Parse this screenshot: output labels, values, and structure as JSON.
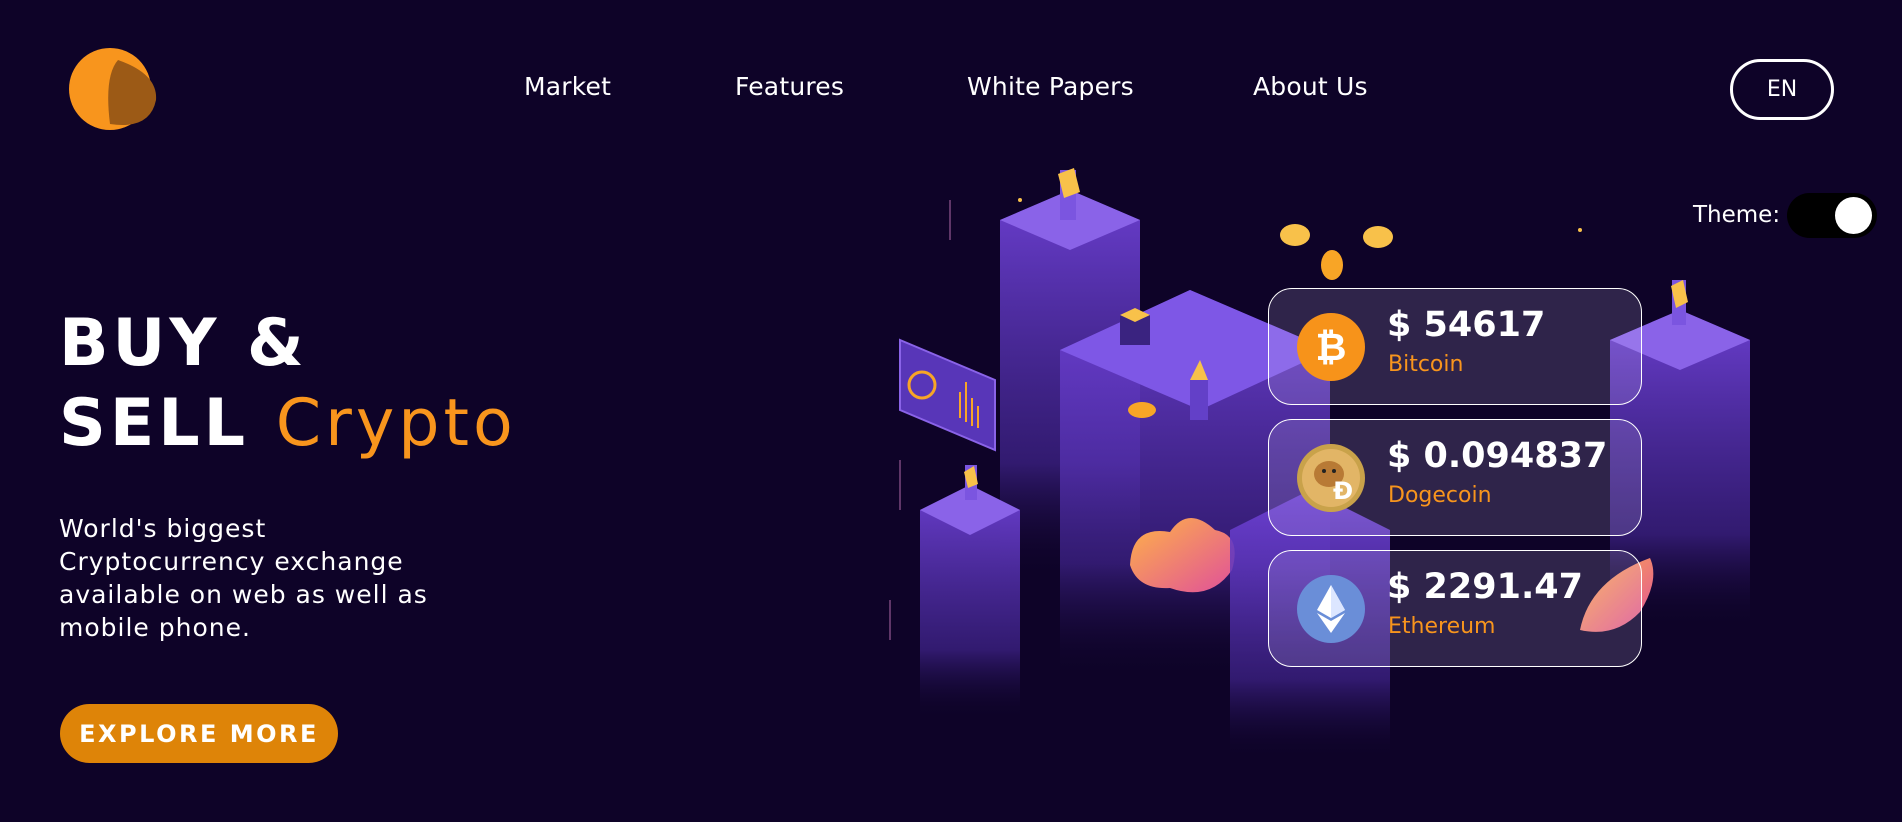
{
  "nav": {
    "items": [
      {
        "label": "Market"
      },
      {
        "label": "Features"
      },
      {
        "label": "White Papers"
      },
      {
        "label": "About Us"
      }
    ],
    "language": "EN"
  },
  "theme": {
    "label": "Theme:",
    "enabled": true
  },
  "hero": {
    "title_line1": "BUY &",
    "title_line2_prefix": "SELL",
    "title_line2_accent": "Crypto",
    "description": "World's biggest Cryptocurrency exchange available on web as well as mobile phone.",
    "cta_label": "EXPLORE MORE"
  },
  "prices": [
    {
      "value": "$ 54617",
      "name": "Bitcoin",
      "icon": "bitcoin-icon"
    },
    {
      "value": "$ 0.094837",
      "name": "Dogecoin",
      "icon": "dogecoin-icon"
    },
    {
      "value": "$ 2291.47",
      "name": "Ethereum",
      "icon": "ethereum-icon"
    }
  ],
  "colors": {
    "background": "#0e0328",
    "accent": "#f8951d",
    "button": "#de8408",
    "illustration_primary": "#6b3fd0"
  }
}
